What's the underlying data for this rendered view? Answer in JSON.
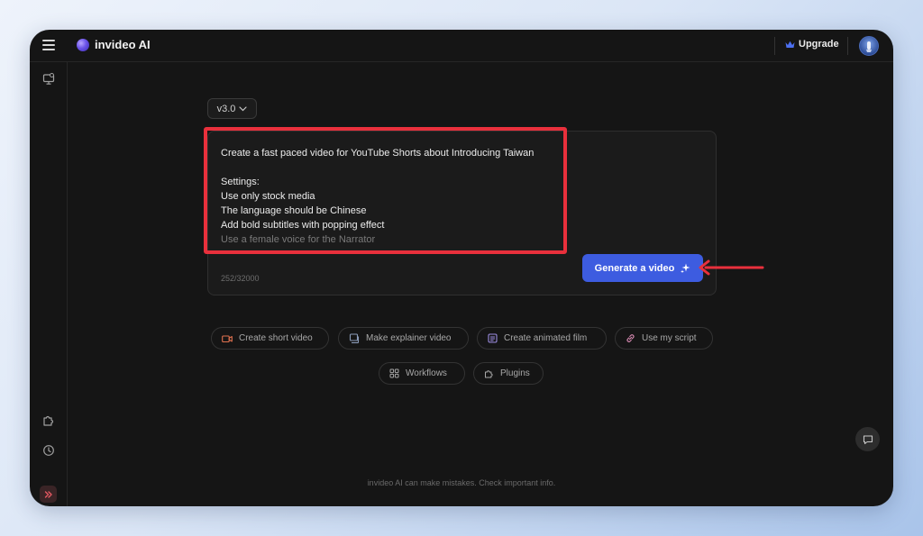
{
  "app": {
    "name": "invideo AI"
  },
  "header": {
    "upgrade_label": "Upgrade"
  },
  "editor": {
    "version_label": "v3.0",
    "prompt_lines": [
      "Create a fast paced video for YouTube Shorts about Introducing Taiwan",
      "",
      "Settings:",
      "Use only stock media",
      "The language should be Chinese",
      "Add bold subtitles with popping effect",
      "Use a female voice for the Narrator"
    ],
    "char_counter": "252/32000",
    "generate_label": "Generate a video"
  },
  "chips": {
    "short_video": "Create short video",
    "explainer": "Make explainer video",
    "animated_film": "Create animated film",
    "script": "Use my script",
    "workflows": "Workflows",
    "plugins": "Plugins"
  },
  "footer": {
    "disclaimer": "invideo AI can make mistakes. Check important info."
  },
  "icons": {
    "menu": "hamburger-icon",
    "logo": "invideo-logo-icon",
    "crown": "crown-icon",
    "sidebar_top": "monitor-icon",
    "plugins": "puzzle-icon",
    "history": "clock-icon",
    "expand": "double-chevron-right-icon",
    "chat": "chat-bubble-icon",
    "sparkle": "sparkle-icon"
  },
  "colors": {
    "window_bg": "#151515",
    "accent_button": "#3d5ce0",
    "highlight_annotation": "#e9303c",
    "crown": "#4c6ff0"
  }
}
